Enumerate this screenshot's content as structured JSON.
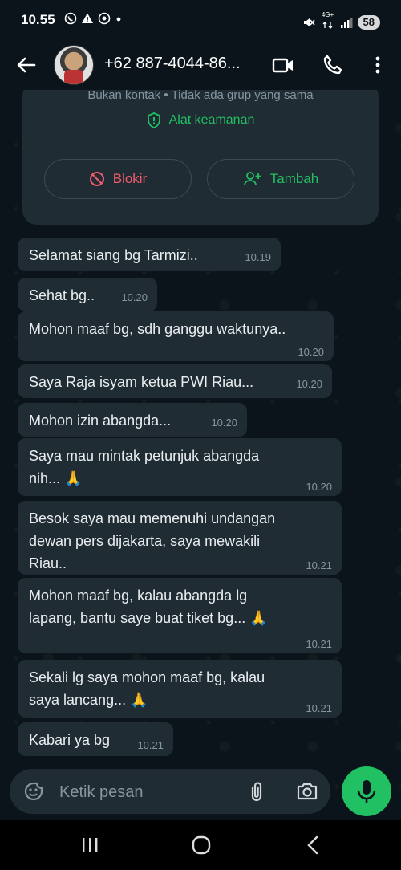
{
  "status_bar": {
    "time": "10.55",
    "battery": "58",
    "network": "4G+"
  },
  "header": {
    "contact_name": "+62 887-4044-86...",
    "icons": [
      "back-arrow-icon",
      "video-call-icon",
      "phone-call-icon",
      "more-vert-icon"
    ]
  },
  "info_card": {
    "subtitle": "Bukan kontak • Tidak ada grup yang sama",
    "security_label": "Alat keamanan",
    "block_label": "Blokir",
    "add_label": "Tambah"
  },
  "messages": [
    {
      "text": "Selamat siang bg Tarmizi..",
      "time": "10.19"
    },
    {
      "text": "Sehat bg..",
      "time": "10.20"
    },
    {
      "text": "Mohon maaf bg, sdh ganggu waktunya..",
      "time": "10.20"
    },
    {
      "text": "Saya Raja isyam ketua PWI Riau...",
      "time": "10.20"
    },
    {
      "text": "Mohon izin abangda...",
      "time": "10.20"
    },
    {
      "line1": "Saya mau mintak petunjuk abangda",
      "line2": "nih... 🙏",
      "time": "10.20"
    },
    {
      "line1": "Besok saya mau memenuhi undangan",
      "line2": "dewan pers dijakarta, saya mewakili",
      "line3": "Riau..",
      "time": "10.21"
    },
    {
      "line1": "Mohon maaf bg, kalau abangda lg",
      "line2": "lapang, bantu saye buat tiket bg... 🙏",
      "time": "10.21"
    },
    {
      "line1": "Sekali lg saya mohon maaf bg, kalau",
      "line2": "saya lancang... 🙏",
      "time": "10.21"
    },
    {
      "text": "Kabari ya bg",
      "time": "10.21"
    }
  ],
  "input": {
    "placeholder": "Ketik pesan",
    "value": ""
  },
  "colors": {
    "background": "#0b141a",
    "bubble": "#1f2c34",
    "accent_green": "#21c063",
    "danger_red": "#f15c6d",
    "muted": "#8696a0"
  }
}
